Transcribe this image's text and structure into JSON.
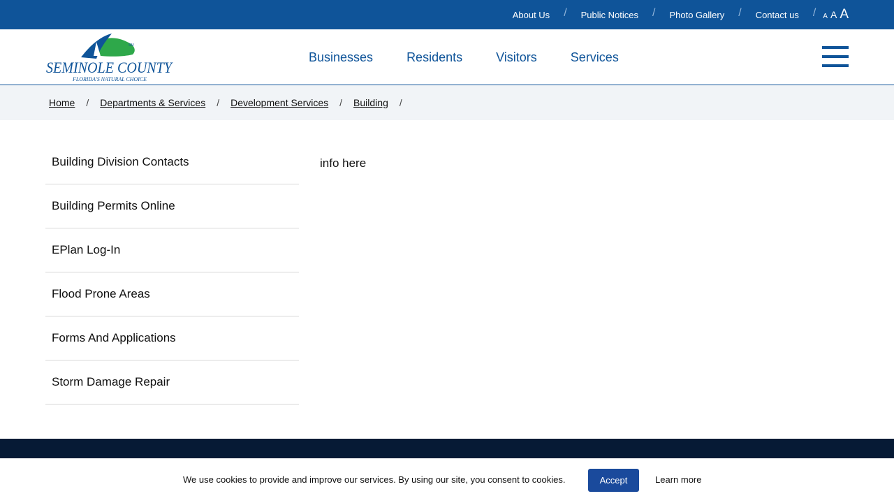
{
  "utility_nav": {
    "links": [
      "About Us",
      "Public Notices",
      "Photo Gallery",
      "Contact us"
    ],
    "separator": "/",
    "font_size_controls": [
      "A",
      "A",
      "A"
    ]
  },
  "header": {
    "logo": {
      "name": "SEMINOLE COUNTY",
      "tagline": "FLORIDA'S NATURAL CHOICE",
      "mark": "SM"
    },
    "main_nav": [
      "Businesses",
      "Residents",
      "Visitors",
      "Services"
    ],
    "menu_icon": "hamburger-menu-icon"
  },
  "breadcrumb": {
    "items": [
      "Home",
      "Departments & Services",
      "Development Services",
      "Building"
    ],
    "separator": "/"
  },
  "side_nav": {
    "items": [
      "Building Division Contacts",
      "Building Permits Online",
      "EPlan Log-In",
      "Flood Prone Areas",
      "Forms And Applications",
      "Storm Damage Repair"
    ]
  },
  "content": {
    "text": "info here"
  },
  "cookie_banner": {
    "message": "We use cookies to provide and improve our services. By using our site, you consent to cookies.",
    "accept_label": "Accept",
    "learn_more_label": "Learn more"
  },
  "colors": {
    "brand_blue": "#0f5499",
    "footer_navy": "#061a35",
    "accept_button": "#1a4a9c",
    "breadcrumb_bg": "#f1f4f7",
    "logo_green": "#2ea84a"
  }
}
